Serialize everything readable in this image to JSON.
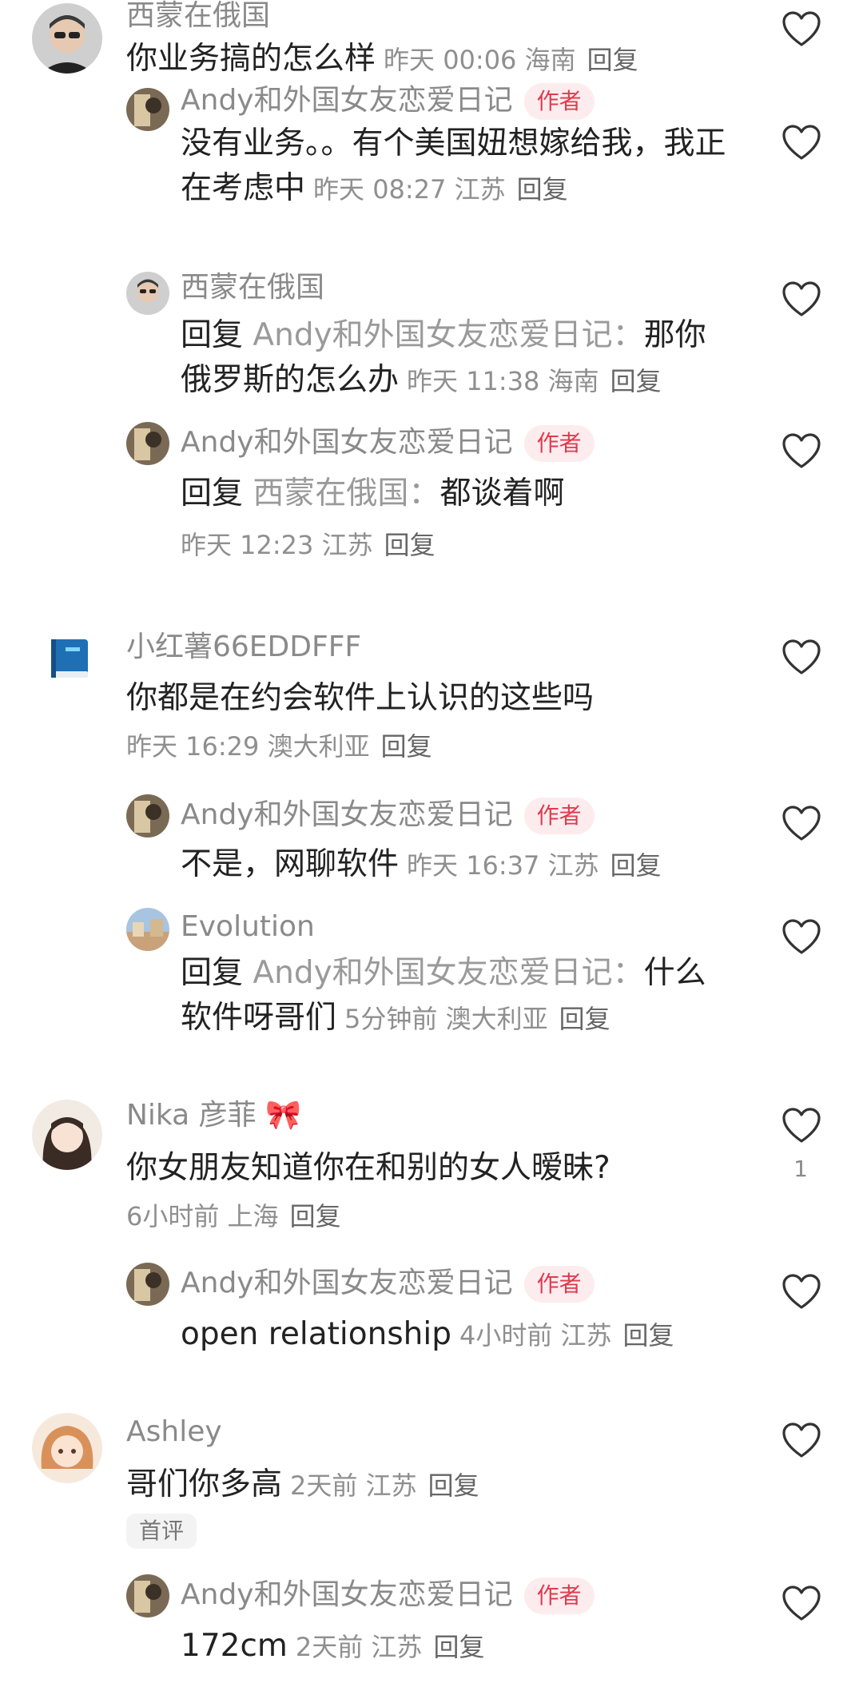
{
  "reply_label": "回复",
  "author_badge": "作者",
  "c1": {
    "user": "西蒙在俄国",
    "text": "你业务搞的怎么样",
    "time": "昨天 00:06",
    "loc": "海南",
    "replies": [
      {
        "user": "Andy和外国女友恋爱日记",
        "text": "没有业务。。有个美国妞想嫁给我，我正在考虑中",
        "time": "昨天 08:27",
        "loc": "江苏"
      },
      {
        "user": "西蒙在俄国",
        "target": "Andy和外国女友恋爱日记：",
        "text": "那你俄罗斯的怎么办",
        "time": "昨天 11:38",
        "loc": "海南"
      },
      {
        "user": "Andy和外国女友恋爱日记",
        "target": "西蒙在俄国：",
        "text": "都谈着啊",
        "time": "昨天 12:23",
        "loc": "江苏"
      }
    ]
  },
  "c2": {
    "user": "小红薯66EDDFFF",
    "text": "你都是在约会软件上认识的这些吗",
    "time": "昨天 16:29",
    "loc": "澳大利亚",
    "replies": [
      {
        "user": "Andy和外国女友恋爱日记",
        "text": "不是，网聊软件",
        "time": "昨天 16:37",
        "loc": "江苏"
      },
      {
        "user": "Evolution",
        "target": "Andy和外国女友恋爱日记：",
        "text": "什么软件呀哥们",
        "time": "5分钟前",
        "loc": "澳大利亚"
      }
    ]
  },
  "c3": {
    "user": "Nika 彦菲",
    "text": "你女朋友知道你在和别的女人暧昧?",
    "time": "6小时前",
    "loc": "上海",
    "likes": "1",
    "replies": [
      {
        "user": "Andy和外国女友恋爱日记",
        "text": "open relationship",
        "time": "4小时前",
        "loc": "江苏"
      }
    ]
  },
  "c4": {
    "user": "Ashley",
    "text": "哥们你多高",
    "time": "2天前",
    "loc": "江苏",
    "tag": "首评",
    "replies": [
      {
        "user": "Andy和外国女友恋爱日记",
        "text": "172cm",
        "time": "2天前",
        "loc": "江苏"
      }
    ]
  },
  "colors": {
    "accent": "#e03a4e",
    "badge_bg": "#fdecee",
    "meta": "#8f8f8f"
  },
  "icons": {
    "like": "heart-outline-icon"
  }
}
